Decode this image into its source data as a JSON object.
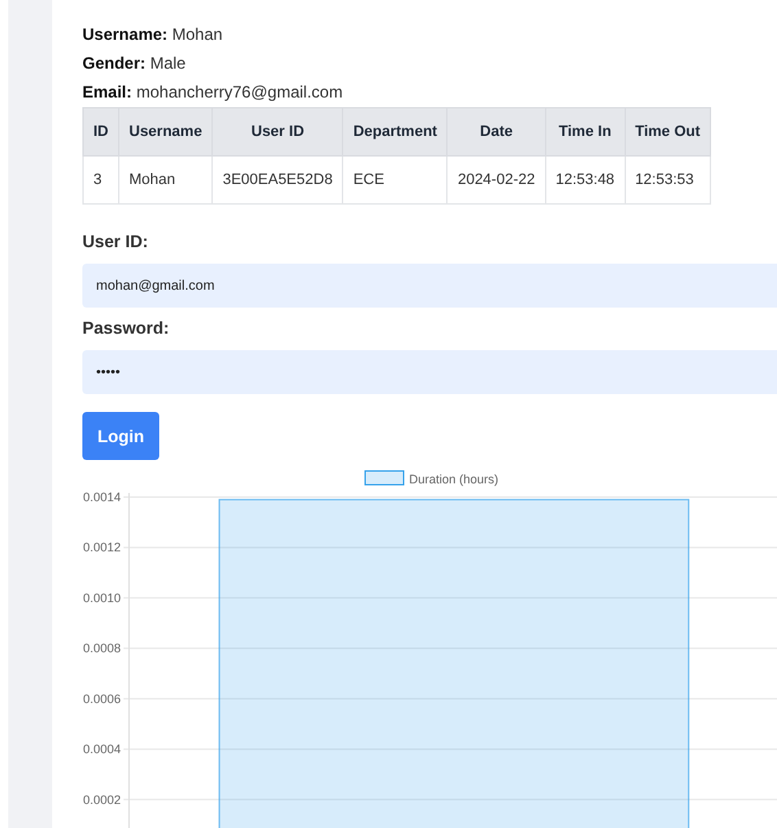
{
  "profile": [
    "**Username:** Mohan",
    "**Gender:** Male",
    "**Email:** mohancherry76@gmail.com"
  ],
  "table": {
    "columns": [
      "ID",
      "Username",
      "User ID",
      "Department",
      "Date",
      "Time In",
      "Time Out"
    ],
    "rows": [
      [
        "3",
        "Mohan",
        "3E00EA5E52D8",
        "ECE",
        "2024-02-22",
        "12:53:48",
        "12:53:53"
      ]
    ]
  },
  "form": {
    "fields": [
      {
        "label": "User ID:",
        "value": "mohan@gmail.com"
      },
      {
        "label": "Password:",
        "value": "•••••"
      }
    ],
    "button": "Login"
  },
  "chart_data": {
    "type": "bar",
    "series": [
      {
        "name": "Duration (hours)",
        "color": "#36a2eb",
        "values": [
          0.00139
        ]
      }
    ],
    "ylim": [
      0,
      0.0014
    ],
    "grid": true,
    "yticks": [
      {
        "value": 0.0002,
        "label": "0.0002"
      },
      {
        "value": 0.0004,
        "label": "0.0004"
      },
      {
        "value": 0.0006,
        "label": "0.0006"
      },
      {
        "value": 0.0008,
        "label": "0.0008"
      },
      {
        "value": 0.001,
        "label": "0.0010"
      },
      {
        "value": 0.0012,
        "label": "0.0012"
      },
      {
        "value": 0.0014,
        "label": "0.0014"
      }
    ]
  }
}
